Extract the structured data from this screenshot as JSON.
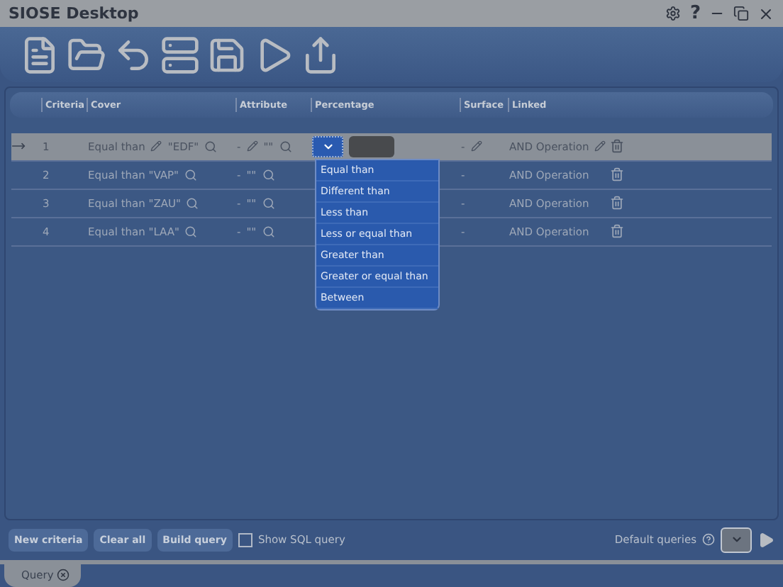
{
  "window": {
    "title": "SIOSE Desktop",
    "help": "?"
  },
  "table": {
    "columns": [
      "Criteria",
      "Cover",
      "Attribute",
      "Percentage",
      "Surface",
      "Linked"
    ],
    "rows": [
      {
        "criteria": "1",
        "cover_operator": "Equal than",
        "cover_value": "\"EDF\"",
        "attribute": "-",
        "attribute_value": "\"\"",
        "surface": "-",
        "linked": "AND Operation",
        "selected": true
      },
      {
        "criteria": "2",
        "cover_operator": "Equal than",
        "cover_value": "\"VAP\"",
        "attribute": "-",
        "attribute_value": "\"\"",
        "surface": "-",
        "linked": "AND Operation",
        "selected": false
      },
      {
        "criteria": "3",
        "cover_operator": "Equal than",
        "cover_value": "\"ZAU\"",
        "attribute": "-",
        "attribute_value": "\"\"",
        "surface": "-",
        "linked": "AND Operation",
        "selected": false
      },
      {
        "criteria": "4",
        "cover_operator": "Equal than",
        "cover_value": "\"LAA\"",
        "attribute": "-",
        "attribute_value": "\"\"",
        "surface": "-",
        "linked": "AND Operation",
        "selected": false
      }
    ]
  },
  "dropdown": {
    "options": [
      {
        "label": "Equal than",
        "selected": false
      },
      {
        "label": "Different than",
        "selected": false
      },
      {
        "label": "Less than",
        "selected": false
      },
      {
        "label": "Less or equal than",
        "selected": false
      },
      {
        "label": "Greater than",
        "selected": false
      },
      {
        "label": "Greater or equal than",
        "selected": false
      },
      {
        "label": "Between",
        "selected": false
      }
    ]
  },
  "buttons": [
    "New criteria",
    "Clear all",
    "Build query"
  ],
  "show_sql": {
    "label": "Show SQL query",
    "checked": false
  },
  "default_queries": {
    "label": "Default queries"
  },
  "tabs": [
    {
      "label": "Query",
      "selected": true
    }
  ]
}
